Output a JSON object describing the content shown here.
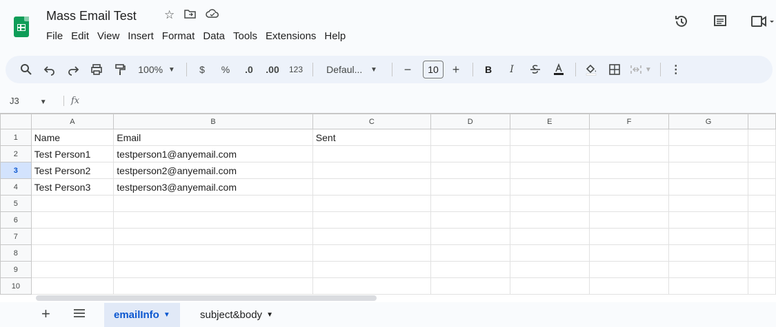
{
  "doc": {
    "title": "Mass Email Test"
  },
  "menu": [
    "File",
    "Edit",
    "View",
    "Insert",
    "Format",
    "Data",
    "Tools",
    "Extensions",
    "Help"
  ],
  "toolbar": {
    "zoom": "100%",
    "currency": "$",
    "percent": "%",
    "dec_decrease": ".0",
    "dec_increase": ".00",
    "number_format": "123",
    "font": "Defaul...",
    "font_size": "10",
    "minus": "−",
    "plus": "+",
    "bold": "B",
    "italic": "I",
    "more": "⋮"
  },
  "formula": {
    "cell_ref": "J3",
    "fx": "fx"
  },
  "columns": [
    "A",
    "B",
    "C",
    "D",
    "E",
    "F",
    "G"
  ],
  "rows": [
    {
      "num": "1",
      "cells": [
        "Name",
        "Email",
        "Sent",
        "",
        "",
        "",
        ""
      ]
    },
    {
      "num": "2",
      "cells": [
        "Test Person1",
        "testperson1@anyemail.com",
        "",
        "",
        "",
        "",
        ""
      ]
    },
    {
      "num": "3",
      "cells": [
        "Test Person2",
        "testperson2@anyemail.com",
        "",
        "",
        "",
        "",
        ""
      ]
    },
    {
      "num": "4",
      "cells": [
        "Test Person3",
        "testperson3@anyemail.com",
        "",
        "",
        "",
        "",
        ""
      ]
    },
    {
      "num": "5",
      "cells": [
        "",
        "",
        "",
        "",
        "",
        "",
        ""
      ]
    },
    {
      "num": "6",
      "cells": [
        "",
        "",
        "",
        "",
        "",
        "",
        ""
      ]
    },
    {
      "num": "7",
      "cells": [
        "",
        "",
        "",
        "",
        "",
        "",
        ""
      ]
    },
    {
      "num": "8",
      "cells": [
        "",
        "",
        "",
        "",
        "",
        "",
        ""
      ]
    },
    {
      "num": "9",
      "cells": [
        "",
        "",
        "",
        "",
        "",
        "",
        ""
      ]
    },
    {
      "num": "10",
      "cells": [
        "",
        "",
        "",
        "",
        "",
        "",
        ""
      ]
    }
  ],
  "selected_row": "3",
  "sheets": [
    {
      "label": "emailInfo",
      "active": true
    },
    {
      "label": "subject&body",
      "active": false
    }
  ],
  "colors": {
    "brand": "#0f9d58",
    "accent": "#0b57d0",
    "toolbar_bg": "#edf2fa"
  }
}
